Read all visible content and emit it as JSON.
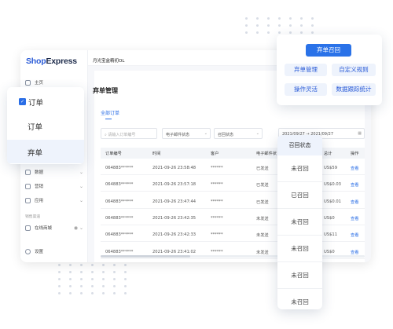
{
  "app": {
    "logo_shop": "Shop",
    "logo_express": "Express",
    "store_name": "月光宝盒精初OL",
    "page_title": "弃单管理",
    "tab_all": "全部订单"
  },
  "sidebar": {
    "home": "主页",
    "data": "数据",
    "marketing": "营销",
    "apps": "应用",
    "section_sales": "销售渠道",
    "online_store": "在线商城",
    "settings": "设置"
  },
  "filters": {
    "search_placeholder": "请输入订单编号",
    "email_status": "电子邮件状态",
    "recall_status": "召回状态",
    "date_start": "2021/09/27",
    "date_sep": "→",
    "date_end": "2021/09/27"
  },
  "table": {
    "headers": {
      "order_no": "订单编号",
      "time": "时间",
      "customer": "客户",
      "email_status": "电子邮件状",
      "total": "总计",
      "action": "操作"
    },
    "rows": [
      {
        "order_no": "064883******",
        "time": "2021-09-26 23:58:48",
        "customer": "******",
        "email": "已发送",
        "total": "US$59",
        "action": "查看"
      },
      {
        "order_no": "064883******",
        "time": "2021-09-26 23:57:18",
        "customer": "******",
        "email": "已发送",
        "total": "US$0.03",
        "action": "查看"
      },
      {
        "order_no": "064883******",
        "time": "2021-09-26 23:47:44",
        "customer": "******",
        "email": "已发送",
        "total": "US$0.01",
        "action": "查看"
      },
      {
        "order_no": "064883******",
        "time": "2021-09-26 23:42:35",
        "customer": "******",
        "email": "未发送",
        "total": "US$0",
        "action": "查看"
      },
      {
        "order_no": "064883******",
        "time": "2021-09-26 23:42:33",
        "customer": "******",
        "email": "未发送",
        "total": "US$11",
        "action": "查看"
      },
      {
        "order_no": "064883******",
        "time": "2021-09-26 23:41:02",
        "customer": "******",
        "email": "未发送",
        "total": "US$0",
        "action": "查看"
      }
    ]
  },
  "popup_left": {
    "items": [
      "订单",
      "订单",
      "弃单"
    ]
  },
  "popup_right": {
    "primary": "弃单召回",
    "b1": "弃单管理",
    "b2": "自定义规则",
    "b3": "操作灵活",
    "b4": "数据跟踪统计"
  },
  "popup_mid": {
    "header": "召回状态",
    "cells": [
      "未召回",
      "已召回",
      "未召回",
      "未召回",
      "未召回",
      "未召回"
    ]
  },
  "colors": {
    "accent": "#2a72e8",
    "soft": "#eef3fc"
  }
}
